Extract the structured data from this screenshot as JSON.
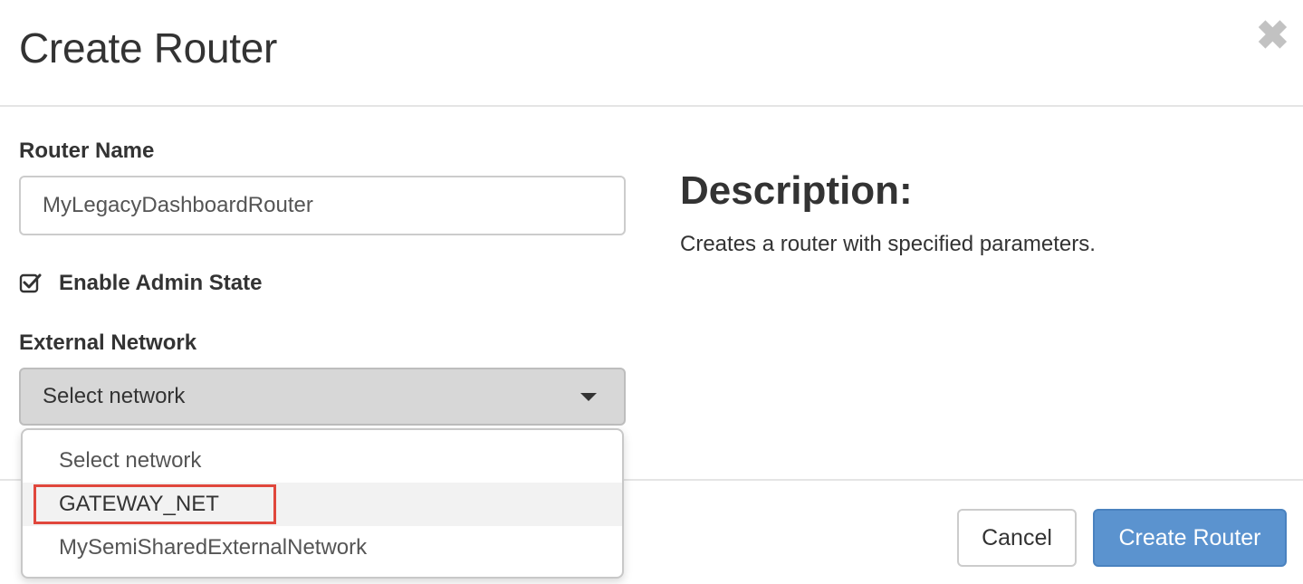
{
  "modal": {
    "title": "Create Router",
    "close_glyph": "✖"
  },
  "form": {
    "router_name_label": "Router Name",
    "router_name_value": "MyLegacyDashboardRouter",
    "admin_state_label": "Enable Admin State",
    "admin_state_checked": true,
    "external_network_label": "External Network",
    "external_network_selected": "Select network",
    "external_network_options": [
      "Select network",
      "GATEWAY_NET",
      "MySemiSharedExternalNetwork"
    ]
  },
  "description": {
    "title": "Description:",
    "text": "Creates a router with specified parameters."
  },
  "footer": {
    "cancel_label": "Cancel",
    "create_label": "Create Router"
  },
  "colors": {
    "primary_button": "#5b93cf",
    "highlight_border": "#e0473c"
  }
}
